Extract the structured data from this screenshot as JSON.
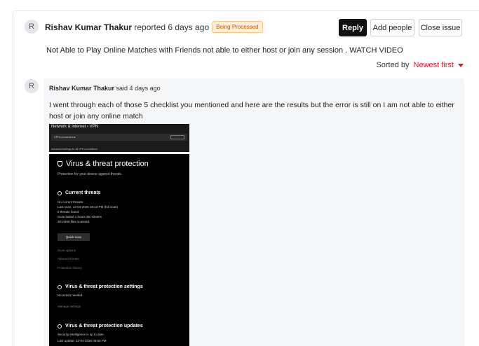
{
  "issue": {
    "avatar_initial": "R",
    "author": "Rishav Kumar Thakur",
    "action_text": "reported 6 days ago",
    "status_badge": "Being Processed",
    "description": "Not Able to Play Online Matches with Friends not able to either host or join any session . WATCH VIDEO"
  },
  "actions": {
    "reply": "Reply",
    "add_people": "Add people",
    "close_issue": "Close issue"
  },
  "sort": {
    "label": "Sorted by",
    "value": "Newest first"
  },
  "comment": {
    "avatar_initial": "R",
    "author": "Rishav Kumar Thakur",
    "action_text": "said 4 days ago",
    "body": "I went through each of those 5 checklist you mentioned and here are the results but the error is still on I am not able to either host or join any online match"
  },
  "screenshot_vpn": {
    "breadcrumb": "Network & internet  ›  VPN",
    "row": "VPN connections",
    "footer": "Advanced settings for all VPN connections"
  },
  "screenshot_virus": {
    "title": "Virus & threat protection",
    "subtitle": "Protection for your device against threats.",
    "current_threats": "Current threats",
    "ct_lines": [
      "No current threats.",
      "Last scan: 12-04-2026 19:13 PM (full scan)",
      "0 threats found.",
      "Scan lasted 1 hours 36 minutes",
      "3014469 files scanned."
    ],
    "quick_scan": "Quick scan",
    "links": [
      "Scan options",
      "Allowed threats",
      "Protection history"
    ],
    "settings_title": "Virus & threat protection settings",
    "settings_status": "No action needed.",
    "settings_link": "Manage settings",
    "updates_title": "Virus & threat protection updates",
    "updates_lines": [
      "Security intelligence is up to date.",
      "Last update: 22-04-2026 09:50 PM"
    ]
  }
}
